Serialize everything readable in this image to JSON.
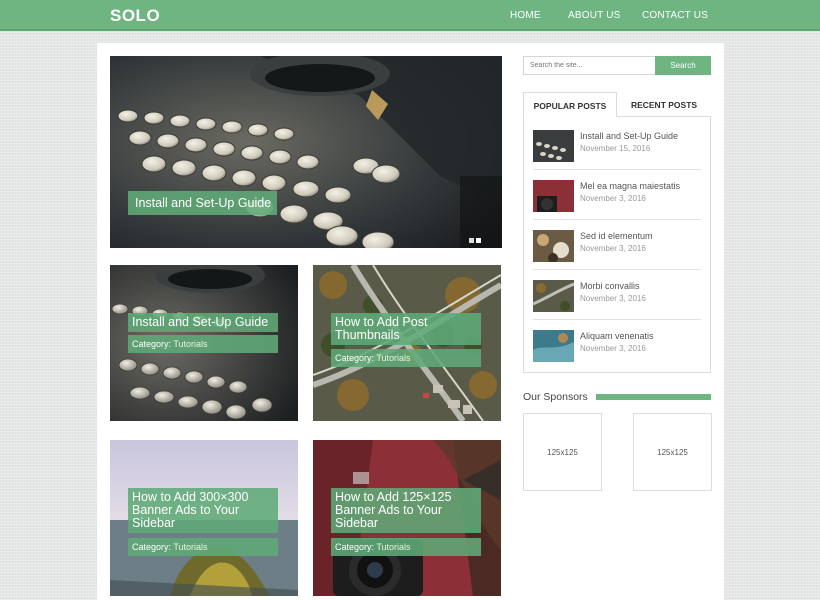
{
  "header": {
    "logo": "SOLO",
    "nav": [
      "HOME",
      "ABOUT US",
      "CONTACT US"
    ]
  },
  "hero": {
    "caption": "Install and Set-Up Guide",
    "slides_count": 2,
    "active_slide": 1
  },
  "posts": [
    {
      "title": "Install and Set-Up Guide",
      "category_label": "Category:",
      "category": "Tutorials"
    },
    {
      "title": "How to Add Post Thumbnails",
      "category_label": "Category:",
      "category": "Tutorials"
    },
    {
      "title": "How to Add 300×300 Banner Ads to Your Sidebar",
      "category_label": "Category:",
      "category": "Tutorials"
    },
    {
      "title": "How to Add 125×125 Banner Ads to Your Sidebar",
      "category_label": "Category:",
      "category": "Tutorials"
    }
  ],
  "sidebar": {
    "search": {
      "placeholder": "Search the site...",
      "button": "Search"
    },
    "tabs": [
      "POPULAR POSTS",
      "RECENT POSTS"
    ],
    "active_tab": "POPULAR POSTS",
    "popular_posts": [
      {
        "title": "Install and Set-Up Guide",
        "date": "November 15, 2016"
      },
      {
        "title": "Mel ea magna maiestatis",
        "date": "November 3, 2016"
      },
      {
        "title": "Sed id elementum",
        "date": "November 3, 2016"
      },
      {
        "title": "Morbi convallis",
        "date": "November 3, 2016"
      },
      {
        "title": "Aliquam venenatis",
        "date": "November 3, 2016"
      }
    ],
    "sponsors": {
      "title": "Our Sponsors",
      "ads": [
        "125x125",
        "125x125"
      ]
    }
  },
  "colors": {
    "accent": "#6fb581",
    "caption_bg": "#60aa78",
    "page_bg": "#e5e6e6"
  }
}
